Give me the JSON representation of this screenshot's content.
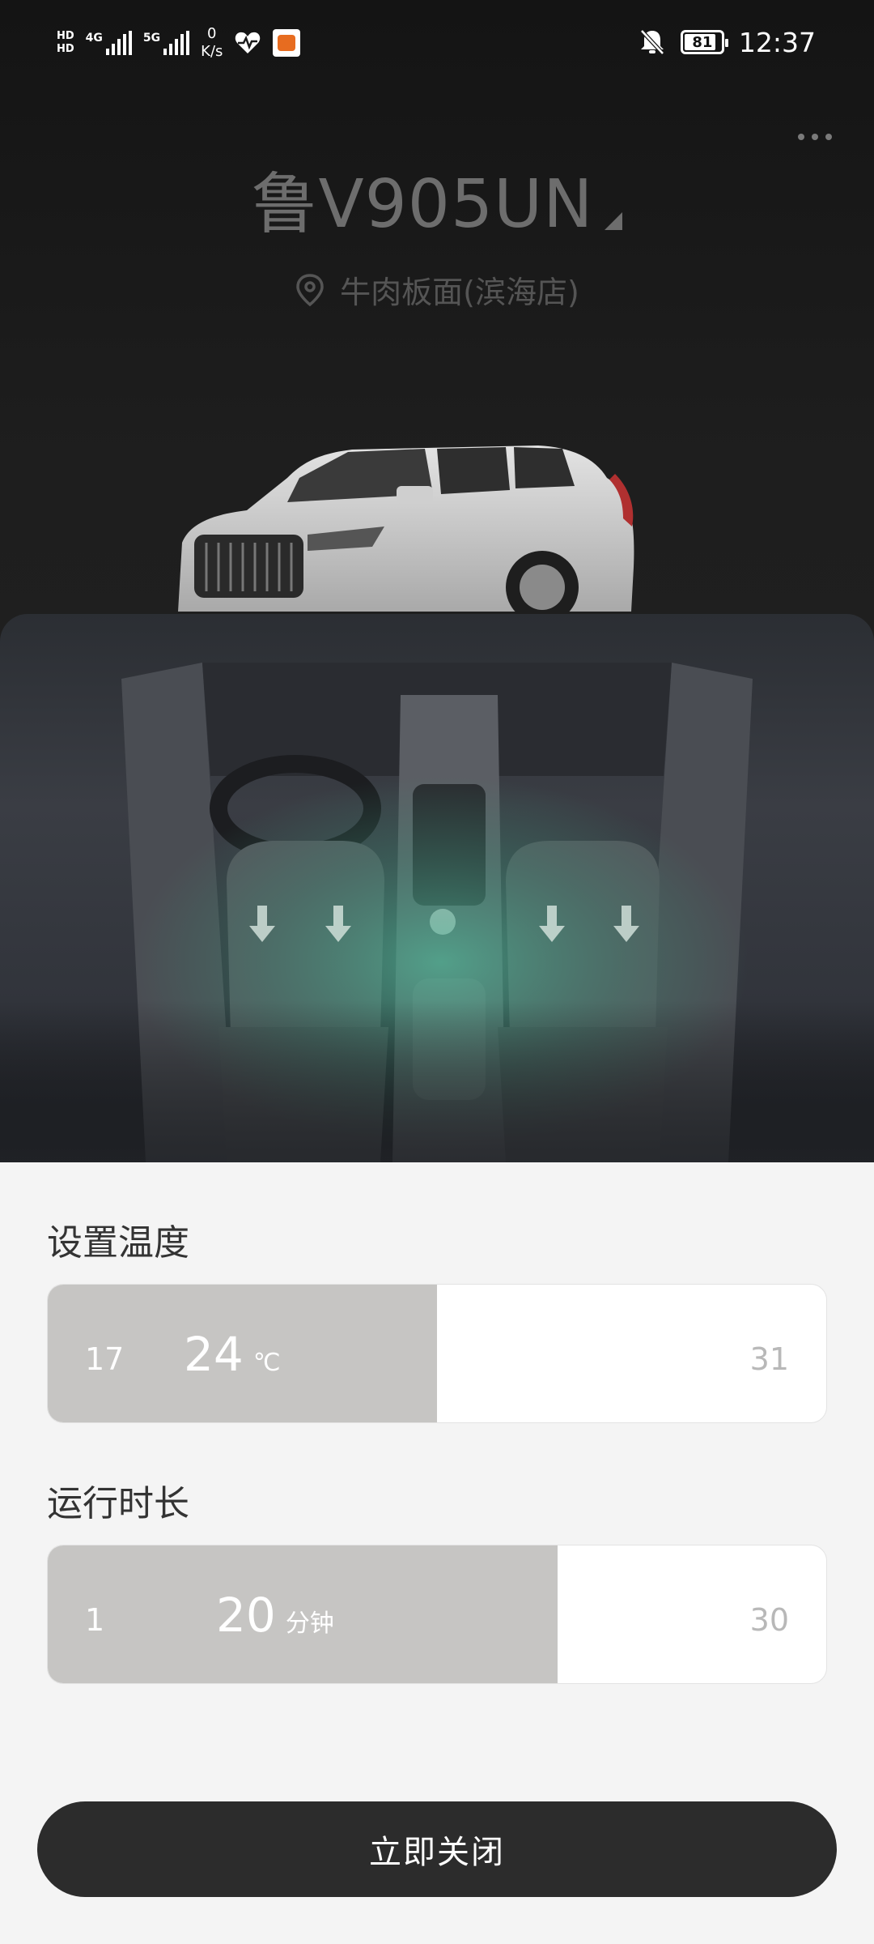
{
  "status_bar": {
    "hd_top": "HD",
    "hd_bottom": "HD",
    "net1": "4G",
    "net2": "5G",
    "speed_value": "0",
    "speed_unit": "K/s",
    "battery": "81",
    "time": "12:37"
  },
  "vehicle": {
    "plate": "鲁V905UN",
    "location": "牛肉板面(滨海店)"
  },
  "temperature": {
    "title": "设置温度",
    "min": "17",
    "max": "31",
    "value": "24",
    "unit": "℃",
    "fill_fraction": 0.5
  },
  "duration": {
    "title": "运行时长",
    "min": "1",
    "max": "30",
    "value": "20",
    "unit": "分钟",
    "fill_fraction": 0.655
  },
  "action_button": "立即关闭",
  "colors": {
    "slider_fill": "#c6c5c3",
    "button_bg": "#2c2c2c",
    "airflow": "#4fb596"
  }
}
